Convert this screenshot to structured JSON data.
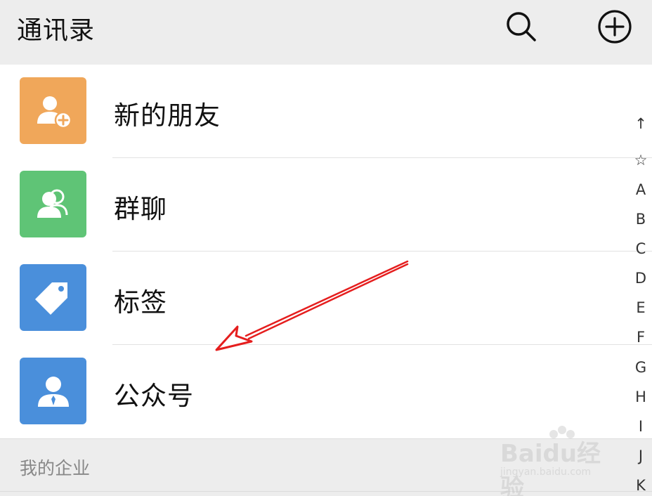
{
  "header": {
    "title": "通讯录",
    "search_icon": "search-icon",
    "add_icon": "add-circle-icon"
  },
  "colors": {
    "new_friends": "#F0A75A",
    "group_chat": "#5FC476",
    "tags": "#4A8FDB",
    "official_accounts": "#4A8FDB",
    "annotation_arrow": "#E51E1E"
  },
  "list": {
    "items": [
      {
        "label": "新的朋友",
        "icon": "add-friend-icon"
      },
      {
        "label": "群聊",
        "icon": "group-icon"
      },
      {
        "label": "标签",
        "icon": "tag-icon"
      },
      {
        "label": "公众号",
        "icon": "official-account-icon"
      }
    ]
  },
  "section": {
    "label": "我的企业"
  },
  "index_bar": {
    "items": [
      "↑",
      "☆",
      "A",
      "B",
      "C",
      "D",
      "E",
      "F",
      "G",
      "H",
      "I",
      "J",
      "K"
    ]
  },
  "watermark": {
    "brand": "Baidu经验",
    "url": "jingyan.baidu.com"
  }
}
